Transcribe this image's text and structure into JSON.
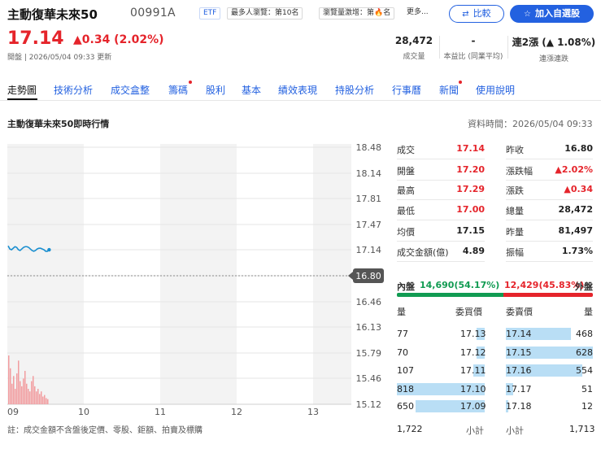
{
  "header": {
    "name": "主動復華未來50",
    "code": "00991A",
    "etf_badge": "ETF",
    "popular_badge": "最多人瀏覽：第10名",
    "volume_badge": "瀏覽量激增：第🔥名",
    "more": "更多...",
    "compare_label": "比較",
    "watchlist_label": "加入自選股"
  },
  "price": {
    "last": "17.14",
    "change": "▲0.34 (2.02%)",
    "status": "開盤 | 2026/05/04 09:33 更新"
  },
  "stats": [
    {
      "value": "28,472",
      "label": "成交量"
    },
    {
      "value": "-",
      "label": "本益比 (同業平均)"
    },
    {
      "value": "連2漲 (▲ 1.08%)",
      "label": "連漲連跌"
    }
  ],
  "tabs": [
    "走勢圖",
    "技術分析",
    "成交盒整",
    "籌碼",
    "股利",
    "基本",
    "績效表現",
    "持股分析",
    "行事曆",
    "新聞",
    "使用說明"
  ],
  "chart_section": {
    "title": "主動復華未來50即時行情",
    "data_time": "資料時間：2026/05/04 09:33"
  },
  "chart_data": {
    "type": "line",
    "y_ticks": [
      "18.48",
      "18.14",
      "17.81",
      "17.47",
      "17.14",
      "16.80",
      "16.46",
      "16.13",
      "15.79",
      "15.46",
      "15.12"
    ],
    "prev_close": "16.80",
    "x_ticks": [
      "09",
      "10",
      "11",
      "12",
      "13"
    ],
    "ylim": [
      15.12,
      18.48
    ],
    "price_series": [
      17.19,
      17.15,
      17.14,
      17.16,
      17.18,
      17.17,
      17.14,
      17.13,
      17.15,
      17.17,
      17.18,
      17.18,
      17.17,
      17.15,
      17.13,
      17.12,
      17.13,
      17.15,
      17.16,
      17.16,
      17.15,
      17.14,
      17.12,
      17.12,
      17.14
    ],
    "last_point": 17.14,
    "volume_series": [
      95,
      70,
      40,
      55,
      30,
      60,
      85,
      45,
      35,
      50,
      65,
      40,
      30,
      25,
      45,
      55,
      35,
      25,
      30,
      20,
      25,
      15,
      18,
      12,
      10
    ],
    "grid": true
  },
  "quote": {
    "left": [
      {
        "label": "成交",
        "value": "17.14",
        "color": "up"
      },
      {
        "label": "開盤",
        "value": "17.20",
        "color": "up"
      },
      {
        "label": "最高",
        "value": "17.29",
        "color": "up"
      },
      {
        "label": "最低",
        "value": "17.00",
        "color": "up"
      },
      {
        "label": "均價",
        "value": "17.15",
        "color": "none"
      },
      {
        "label": "成交金額(億)",
        "value": "4.89",
        "color": "none"
      }
    ],
    "right": [
      {
        "label": "昨收",
        "value": "16.80",
        "color": "none"
      },
      {
        "label": "漲跌幅",
        "value": "▲2.02%",
        "color": "up"
      },
      {
        "label": "漲跌",
        "value": "▲0.34",
        "color": "up"
      },
      {
        "label": "總量",
        "value": "28,472",
        "color": "none"
      },
      {
        "label": "昨量",
        "value": "81,497",
        "color": "none"
      },
      {
        "label": "振幅",
        "value": "1.73%",
        "color": "none"
      }
    ]
  },
  "inout": {
    "inner_label": "內盤",
    "inner_value": "14,690(54.17%)",
    "outer_value": "12,429(45.83%)",
    "outer_label": "外盤",
    "inner_fraction": 0.5417
  },
  "orderbook": {
    "headers": {
      "bid_qty": "量",
      "bid_price": "委買價",
      "ask_price": "委賣價",
      "ask_qty": "量"
    },
    "bids": [
      {
        "qty": "77",
        "price": "17.13",
        "fraction": 0.09
      },
      {
        "qty": "70",
        "price": "17.12",
        "fraction": 0.09
      },
      {
        "qty": "107",
        "price": "17.11",
        "fraction": 0.13
      },
      {
        "qty": "818",
        "price": "17.10",
        "fraction": 1.0
      },
      {
        "qty": "650",
        "price": "17.09",
        "fraction": 0.79
      }
    ],
    "asks": [
      {
        "price": "17.14",
        "qty": "468",
        "fraction": 0.75
      },
      {
        "price": "17.15",
        "qty": "628",
        "fraction": 1.0
      },
      {
        "price": "17.16",
        "qty": "554",
        "fraction": 0.88
      },
      {
        "price": "17.17",
        "qty": "51",
        "fraction": 0.08
      },
      {
        "price": "17.18",
        "qty": "12",
        "fraction": 0.02
      }
    ],
    "footer": {
      "bid_total": "1,722",
      "label": "小計",
      "ask_total": "1,713"
    }
  },
  "note": "註：成交金額不含盤後定價、零股、鉅額、拍賣及標購",
  "colors": {
    "up": "#e5242b",
    "down": "#119b52",
    "accent": "#2361e0",
    "line": "#1a8fd0",
    "volume": "#f29c9f"
  }
}
